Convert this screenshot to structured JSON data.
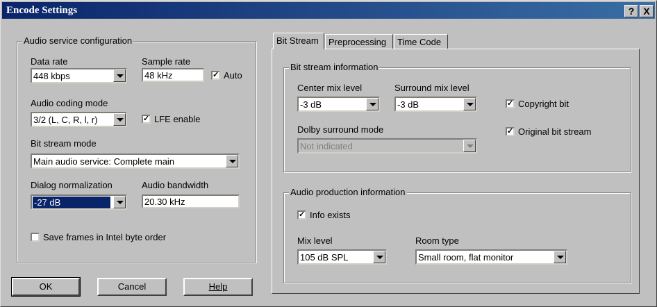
{
  "window": {
    "title": "Encode Settings",
    "help_glyph": "?",
    "close_glyph": "X"
  },
  "audio_service": {
    "legend": "Audio service configuration",
    "data_rate": {
      "label": "Data rate",
      "value": "448 kbps"
    },
    "sample_rate": {
      "label": "Sample rate",
      "value": "48 kHz"
    },
    "auto": {
      "label": "Auto",
      "checked": true
    },
    "coding_mode": {
      "label": "Audio coding mode",
      "value": "3/2 (L, C, R, l, r)"
    },
    "lfe": {
      "label": "LFE enable",
      "checked": true
    },
    "bit_stream_mode": {
      "label": "Bit stream mode",
      "value": "Main audio service: Complete main"
    },
    "dialog_norm": {
      "label": "Dialog normalization",
      "value": "-27 dB"
    },
    "bandwidth": {
      "label": "Audio bandwidth",
      "value": "20.30 kHz"
    },
    "save_frames": {
      "label": "Save frames in Intel byte order",
      "checked": false
    }
  },
  "buttons": {
    "ok": "OK",
    "cancel": "Cancel",
    "help": "Help"
  },
  "tabs": [
    "Bit Stream",
    "Preprocessing",
    "Time Code"
  ],
  "bit_stream_info": {
    "legend": "Bit stream information",
    "center_mix": {
      "label": "Center mix level",
      "value": "-3 dB"
    },
    "surround_mix": {
      "label": "Surround mix level",
      "value": "-3 dB"
    },
    "copyright": {
      "label": "Copyright bit",
      "checked": true
    },
    "original": {
      "label": "Original bit stream",
      "checked": true
    },
    "dolby_surround": {
      "label": "Dolby surround mode",
      "value": "Not indicated"
    }
  },
  "production_info": {
    "legend": "Audio production information",
    "info_exists": {
      "label": "Info exists",
      "checked": true
    },
    "mix_level": {
      "label": "Mix level",
      "value": "105 dB SPL"
    },
    "room_type": {
      "label": "Room type",
      "value": "Small room, flat monitor"
    }
  },
  "check_glyph": "✓"
}
